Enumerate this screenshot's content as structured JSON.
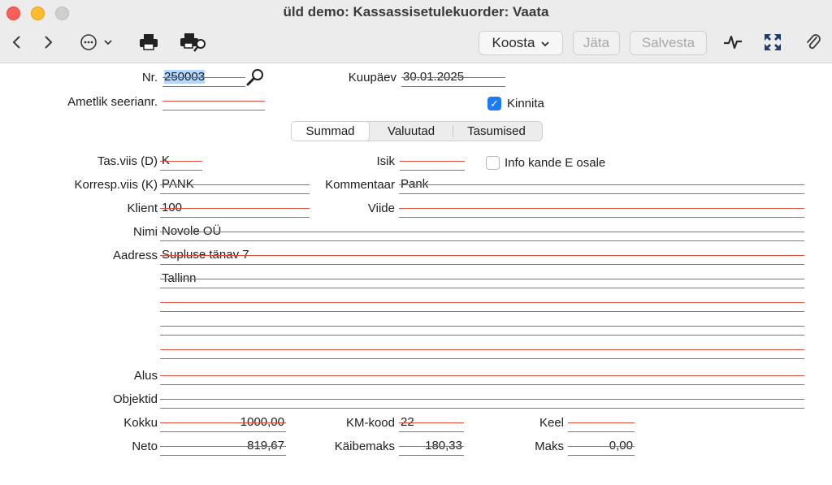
{
  "window": {
    "title": "üld demo: Kassassisetulekuorder: Vaata"
  },
  "toolbar": {
    "koosta_label": "Koosta",
    "jata_label": "Jäta",
    "salvesta_label": "Salvesta",
    "icons": [
      "back-icon",
      "forward-icon",
      "more-icon",
      "print-icon",
      "print-preview-icon",
      "activity-icon",
      "expand-icon",
      "attachment-icon"
    ]
  },
  "header": {
    "nr_label": "Nr.",
    "nr_value": "250003",
    "ametlik_label": "Ametlik seerianr.",
    "ametlik_value": "",
    "kuupaev_label": "Kuupäev",
    "kuupaev_value": "30.01.2025",
    "kinnita_label": "Kinnita",
    "kinnita_checked": true
  },
  "tabs": [
    "Summad",
    "Valuutad",
    "Tasumised"
  ],
  "form": {
    "tasviis_label": "Tas.viis (D)",
    "tasviis_value": "K",
    "isik_label": "Isik",
    "isik_value": "",
    "info_label": "Info kande E osale",
    "info_checked": false,
    "korresp_label": "Korresp.viis (K)",
    "korresp_value": "PANK",
    "kommentaar_label": "Kommentaar",
    "kommentaar_value": "Pank",
    "klient_label": "Klient",
    "klient_value": "100",
    "viide_label": "Viide",
    "viide_value": "",
    "nimi_label": "Nimi",
    "nimi_value": "Novole OÜ",
    "aadress_label": "Aadress",
    "aadress_lines": [
      "Supluse tänav 7",
      "Tallinn",
      "",
      "",
      ""
    ],
    "alus_label": "Alus",
    "alus_value": "",
    "objektid_label": "Objektid",
    "objektid_value": ""
  },
  "totals": {
    "kokku_label": "Kokku",
    "kokku_value": "1000,00",
    "kmkood_label": "KM-kood",
    "kmkood_value": "22",
    "keel_label": "Keel",
    "keel_value": "",
    "neto_label": "Neto",
    "neto_value": "819,67",
    "kaibemaks_label": "Käibemaks",
    "kaibemaks_value": "180,33",
    "maks_label": "Maks",
    "maks_value": "0,00"
  }
}
